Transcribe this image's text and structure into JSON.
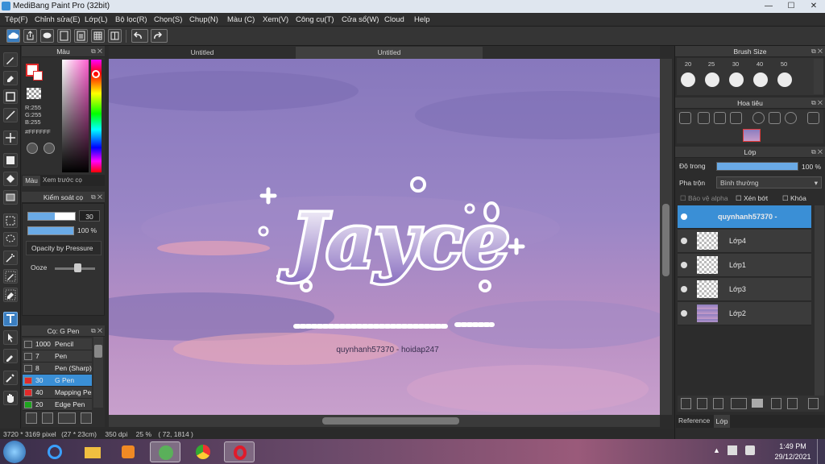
{
  "window": {
    "title": "MediBang Paint Pro (32bit)",
    "minimize": "—",
    "maximize": "☐",
    "close": "✕"
  },
  "menu": [
    "Tệp(F)",
    "Chỉnh sửa(E)",
    "Lớp(L)",
    "Bộ lọc(R)",
    "Chọn(S)",
    "Chụp(N)",
    "Màu (C)",
    "Xem(V)",
    "Công cụ(T)",
    "Cửa sổ(W)",
    "Cloud",
    "Help"
  ],
  "toolbar_icons": [
    "cloud-icon",
    "share-icon",
    "comment-icon",
    "page-icon",
    "document-icon",
    "grid-icon",
    "layout-icon",
    "undo-icon",
    "redo-icon"
  ],
  "tools": [
    "brush-icon",
    "eraser-icon",
    "rectangle-icon",
    "line-icon",
    "move-icon",
    "fill-rectangle-icon",
    "bucket-icon",
    "gradient-icon",
    "select-rect-icon",
    "lasso-icon",
    "magic-wand-icon",
    "select-pen-icon",
    "select-eraser-icon",
    "text-icon",
    "operation-icon",
    "eyedropper-icon",
    "dropper-icon",
    "hand-icon"
  ],
  "color_panel": {
    "title": "Màu",
    "r": "R:255",
    "g": "G:255",
    "b": "B:255",
    "hex": "#FFFFFF",
    "tabs": [
      "Màu",
      "Xem trước cọ"
    ]
  },
  "brush_control": {
    "title": "Kiểm soát cọ",
    "size": "30",
    "opacity": "100 %",
    "option": "Opacity by Pressure",
    "ooze_label": "Ooze"
  },
  "brush_list": {
    "title": "Cọ: G Pen",
    "items": [
      {
        "size": "1000",
        "name": "Pencil",
        "color": "#3b3b3b",
        "selected": false
      },
      {
        "size": "7",
        "name": "Pen",
        "color": "#3b3b3b",
        "selected": false
      },
      {
        "size": "8",
        "name": "Pen (Sharp)",
        "color": "#3b3b3b",
        "selected": false
      },
      {
        "size": "30",
        "name": "G Pen",
        "color": "#e22a2a",
        "selected": true
      },
      {
        "size": "40",
        "name": "Mapping Pen",
        "color": "#e22a2a",
        "selected": false
      },
      {
        "size": "20",
        "name": "Edge Pen",
        "color": "#1ea51e",
        "selected": false
      }
    ]
  },
  "tabs": [
    "Untitled",
    "Untitled"
  ],
  "canvas": {
    "logo_text": "Jayce",
    "credit": "quynhanh57370 - hoidap247"
  },
  "status": {
    "size": "3720 * 3169 pixel",
    "cm": "(27 * 23cm)",
    "dpi": "350 dpi",
    "zoom": "25 %",
    "pos": "( 72, 1814 )"
  },
  "brush_size": {
    "title": "Brush Size",
    "sizes": [
      "20",
      "25",
      "30",
      "40",
      "50"
    ]
  },
  "navigator": {
    "title": "Hoa tiêu"
  },
  "layers": {
    "title": "Lớp",
    "opacity_label": "Độ trong",
    "opacity_value": "100 %",
    "opacity_fraction": 1.0,
    "blend_label": "Pha trộn",
    "blend_value": "Bình thường",
    "protect_alpha": "Bảo vệ alpha",
    "clipping": "Xén bớt",
    "lock": "Khóa",
    "items": [
      {
        "name": "quynhanh57370 -",
        "selected": true
      },
      {
        "name": "Lớp4",
        "selected": false
      },
      {
        "name": "Lớp1",
        "selected": false
      },
      {
        "name": "Lớp3",
        "selected": false
      },
      {
        "name": "Lớp2",
        "selected": false
      }
    ],
    "bottom_tabs": [
      "Reference",
      "Lớp"
    ]
  },
  "taskbar": {
    "time": "1:49 PM",
    "date": "29/12/2021"
  },
  "colors": {
    "accent": "#3a8fd6",
    "canvas_top": "#8a7fc2",
    "canvas_bottom": "#c898c8"
  }
}
